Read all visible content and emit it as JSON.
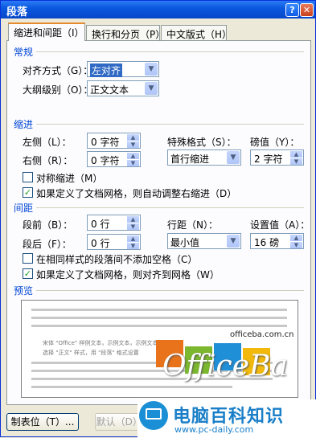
{
  "window": {
    "title": "段落",
    "help_icon": "?",
    "close_icon": "✕"
  },
  "tabs": [
    {
      "label": "缩进和间距（I）",
      "active": true
    },
    {
      "label": "换行和分页（P）",
      "active": false
    },
    {
      "label": "中文版式（H）",
      "active": false
    }
  ],
  "general": {
    "section_label": "常规",
    "alignment_label": "对齐方式（G）：",
    "alignment_value": "左对齐",
    "outline_label": "大纲级别（O）：",
    "outline_value": "正文文本"
  },
  "indent": {
    "section_label": "缩进",
    "left_label": "左侧（L）：",
    "left_value": "0 字符",
    "right_label": "右侧（R）：",
    "right_value": "0 字符",
    "special_label": "特殊格式（S）：",
    "special_value": "首行缩进",
    "by_label": "磅值（Y）：",
    "by_value": "2 字符",
    "mirror_label": "对称缩进（M）",
    "mirror_checked": false,
    "autoadjust_label": "如果定义了文档网格，则自动调整右缩进（D）",
    "autoadjust_checked": true
  },
  "spacing": {
    "section_label": "间距",
    "before_label": "段前（B）：",
    "before_value": "0 行",
    "after_label": "段后（F）：",
    "after_value": "0 行",
    "line_label": "行距（N）：",
    "line_value": "最小值",
    "at_label": "设置值（A）：",
    "at_value": "16 磅",
    "nospace_label": "在相同样式的段落间不添加空格（C）",
    "nospace_checked": false,
    "snapgrid_label": "如果定义了文档网格，则对齐到网格（W）",
    "snapgrid_checked": true
  },
  "preview": {
    "section_label": "预览",
    "sample_text_1": "宋体 \"Office\" 样例文本，示例文本，示例文本",
    "sample_text_2": "选择 \"正文\" 样式，用 \"段落\" 格式设置"
  },
  "watermark": {
    "site": "officeba.com.cn",
    "word": "OfficeBa"
  },
  "branding": {
    "name": "电脑百科知识",
    "url": "www.pc-daily.com"
  },
  "buttons": {
    "tabs_label": "制表位（T）...",
    "default_label": "默认（D）..."
  },
  "colors": {
    "title_bar": "#0a59e0",
    "section_label": "#0046d5",
    "active_tab_accent": "#e68b2c",
    "brand": "#1a7fc8"
  }
}
